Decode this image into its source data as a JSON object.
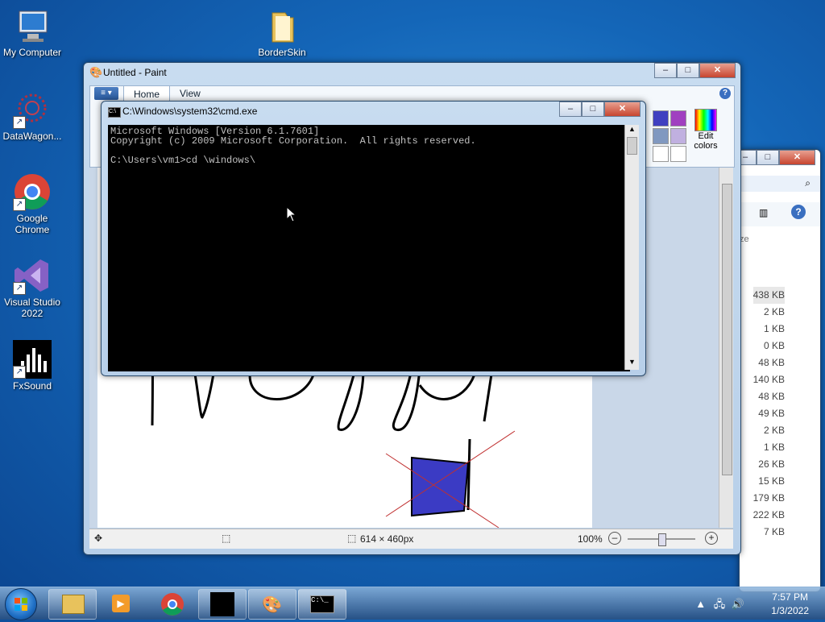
{
  "desktop": {
    "icons": [
      {
        "label": "My Computer",
        "icon": "computer-icon"
      },
      {
        "label": "BorderSkin",
        "icon": "folder-icon"
      },
      {
        "label": "DataWagon...",
        "icon": "app-icon"
      },
      {
        "label": "Google Chrome",
        "icon": "chrome-icon"
      },
      {
        "label": "Visual Studio 2022",
        "icon": "visual-studio-icon"
      },
      {
        "label": "FxSound",
        "icon": "fxsound-icon"
      }
    ]
  },
  "paint": {
    "title": "Untitled - Paint",
    "tabs": [
      "Home",
      "View"
    ],
    "edit_colors": "Edit colors",
    "status": {
      "dimensions": "614 × 460px",
      "zoom": "100%"
    }
  },
  "cmd": {
    "title": "C:\\Windows\\system32\\cmd.exe",
    "lines": [
      "Microsoft Windows [Version 6.1.7601]",
      "Copyright (c) 2009 Microsoft Corporation.  All rights reserved.",
      "",
      "C:\\Users\\vm1>cd \\windows\\"
    ]
  },
  "explorer": {
    "partial_header": "ze",
    "sizes": [
      "438 KB",
      "2 KB",
      "1 KB",
      "0 KB",
      "48 KB",
      "140 KB",
      "48 KB",
      "49 KB",
      "2 KB",
      "1 KB",
      "26 KB",
      "15 KB",
      "179 KB",
      "222 KB",
      "7 KB"
    ]
  },
  "taskbar": {
    "time": "7:57 PM",
    "date": "1/3/2022",
    "buttons": [
      "explorer",
      "media-player",
      "chrome",
      "fxsound",
      "paint",
      "cmd"
    ]
  },
  "colors": {
    "accent": "#1f6fc5",
    "palette": [
      "#4040c0",
      "#a040c0",
      "#8098c0",
      "#c0b0e0"
    ]
  }
}
